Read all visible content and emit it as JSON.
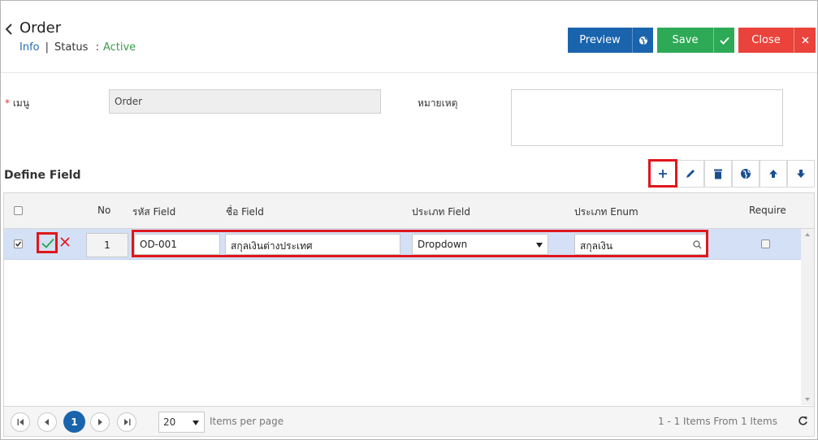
{
  "header": {
    "title": "Order",
    "info_link": "Info",
    "separator": "|",
    "status_label": "Status",
    "status_colon": ":",
    "status_value": "Active"
  },
  "actions": {
    "preview_label": "Preview",
    "save_label": "Save",
    "close_label": "Close"
  },
  "form": {
    "menu_label": "เมนู",
    "menu_required_mark": "*",
    "menu_value": "Order",
    "remark_label": "หมายเหตุ",
    "remark_value": ""
  },
  "section": {
    "title": "Define Field"
  },
  "toolbar": {
    "icons": [
      "plus-icon",
      "pencil-icon",
      "trash-icon",
      "globe-icon",
      "arrow-up-icon",
      "arrow-down-icon"
    ]
  },
  "grid": {
    "columns": {
      "no": "No",
      "field_code": "รหัส Field",
      "field_name": "ชื่อ Field",
      "field_type": "ประเภท Field",
      "enum_type": "ประเภท Enum",
      "require": "Require"
    },
    "rows": [
      {
        "selected": true,
        "no": "1",
        "field_code": "OD-001",
        "field_name": "สกุลเงินต่างประเทศ",
        "field_type": "Dropdown",
        "enum_type": "สกุลเงิน",
        "require": false
      }
    ]
  },
  "pager": {
    "current_page": "1",
    "page_size": "20",
    "items_per_page_label": "Items per page",
    "summary": "1 - 1 Items From 1 Items"
  },
  "colors": {
    "primary": "#1a64ad",
    "success": "#2eaa56",
    "danger": "#e9433b",
    "highlight": "#e0161c",
    "selected_row": "#d4e0f5"
  }
}
